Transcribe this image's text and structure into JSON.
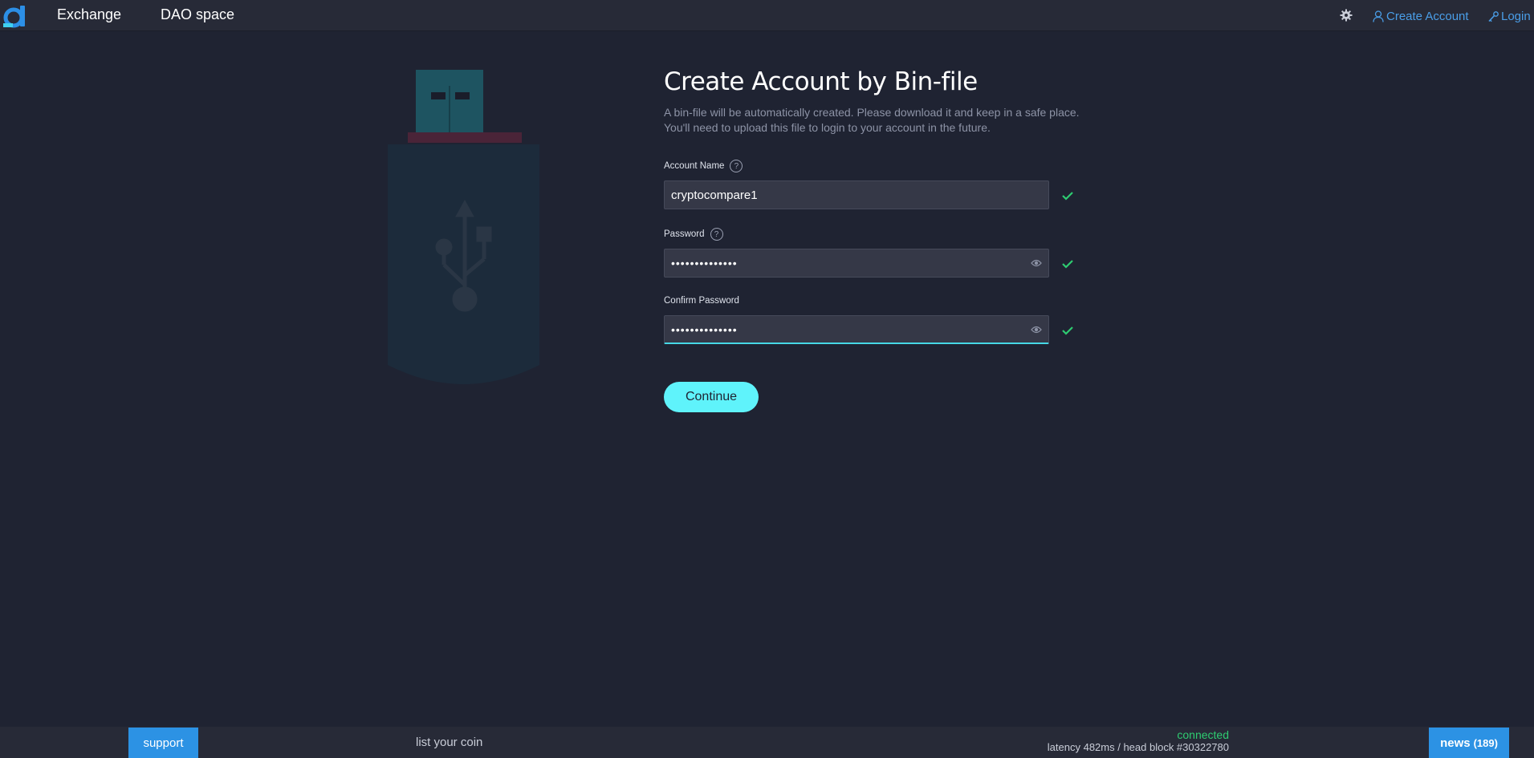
{
  "nav": {
    "exchange": "Exchange",
    "dao_space": "DAO space",
    "create_account": "Create Account",
    "login": "Login"
  },
  "form": {
    "title": "Create Account by Bin-file",
    "subtitle_line1": "A bin-file will be automatically created. Please download it and keep in a safe place.",
    "subtitle_line2": "You'll need to upload this file to login to your account in the future.",
    "account_name_label": "Account Name",
    "account_name_value": "cryptocompare1",
    "password_label": "Password",
    "password_value": "••••••••••••••",
    "confirm_password_label": "Confirm Password",
    "confirm_password_value": "••••••••••••••",
    "help_glyph": "?",
    "continue_label": "Continue"
  },
  "footer": {
    "support": "support",
    "list_coin": "list your coin",
    "status": "connected",
    "latency": "latency 482ms / head block #30322780",
    "news": "news",
    "news_count": "(189)"
  },
  "colors": {
    "background": "#1f2332",
    "bar": "#272a37",
    "accent_link": "#4a9ee8",
    "button": "#5ff3fb",
    "valid": "#2ecc71",
    "footer_button": "#2c92e4"
  }
}
